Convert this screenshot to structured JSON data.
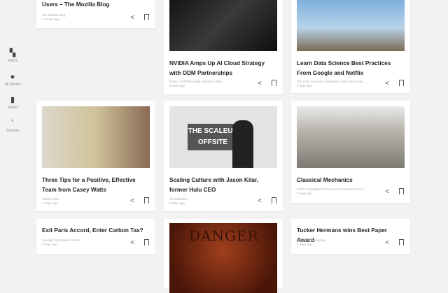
{
  "sidebar": {
    "items": [
      {
        "label": "Topics",
        "icon": "topics-icon"
      },
      {
        "label": "All Stories",
        "icon": "all-stories-icon"
      },
      {
        "label": "Saved",
        "icon": "bookmark-icon"
      },
      {
        "label": "Sources",
        "icon": "rss-icon"
      }
    ]
  },
  "cards": [
    {
      "title": "Users – The Mozilla Blog",
      "source": "The Mozilla Blog",
      "time": "2 weeks ago"
    },
    {
      "title": "NVIDIA Amps Up AI Cloud Strategy with ODM Partnerships",
      "source": "News | TOP500 Supercomputer Sites",
      "time": "2 days ago"
    },
    {
      "title": "Learn Data Science Best Practices From Google and Netflix",
      "source": "The Data Science Companies | Best Data Science Co...",
      "time": "2 days ago"
    },
    {
      "title": "Three Tips for a Positive, Effective Team from Casey Watts",
      "source": "Atomic Spin",
      "time": "2 days ago"
    },
    {
      "title": "Scaling Culture with Jason Kilar, former Hulu CEO",
      "source": "Ycombinator",
      "time": "2 days ago"
    },
    {
      "title": "Classical Mechanics",
      "source": "UCR Computational Physics Conversation | Free Onl...",
      "time": "2 days ago"
    },
    {
      "title": "Exit Paris Accord, Enter Carbon Tax?",
      "source": "Georgia Tech News Center",
      "time": "2 days ago"
    },
    {
      "title": "Tucker Hermans wins Best Paper Award",
      "source": "School of Computing",
      "time": "2 days ago"
    }
  ],
  "images": {
    "scaleup_sign": "THE SCALEUP OFFSITE",
    "danger_sign": "DANGER"
  }
}
